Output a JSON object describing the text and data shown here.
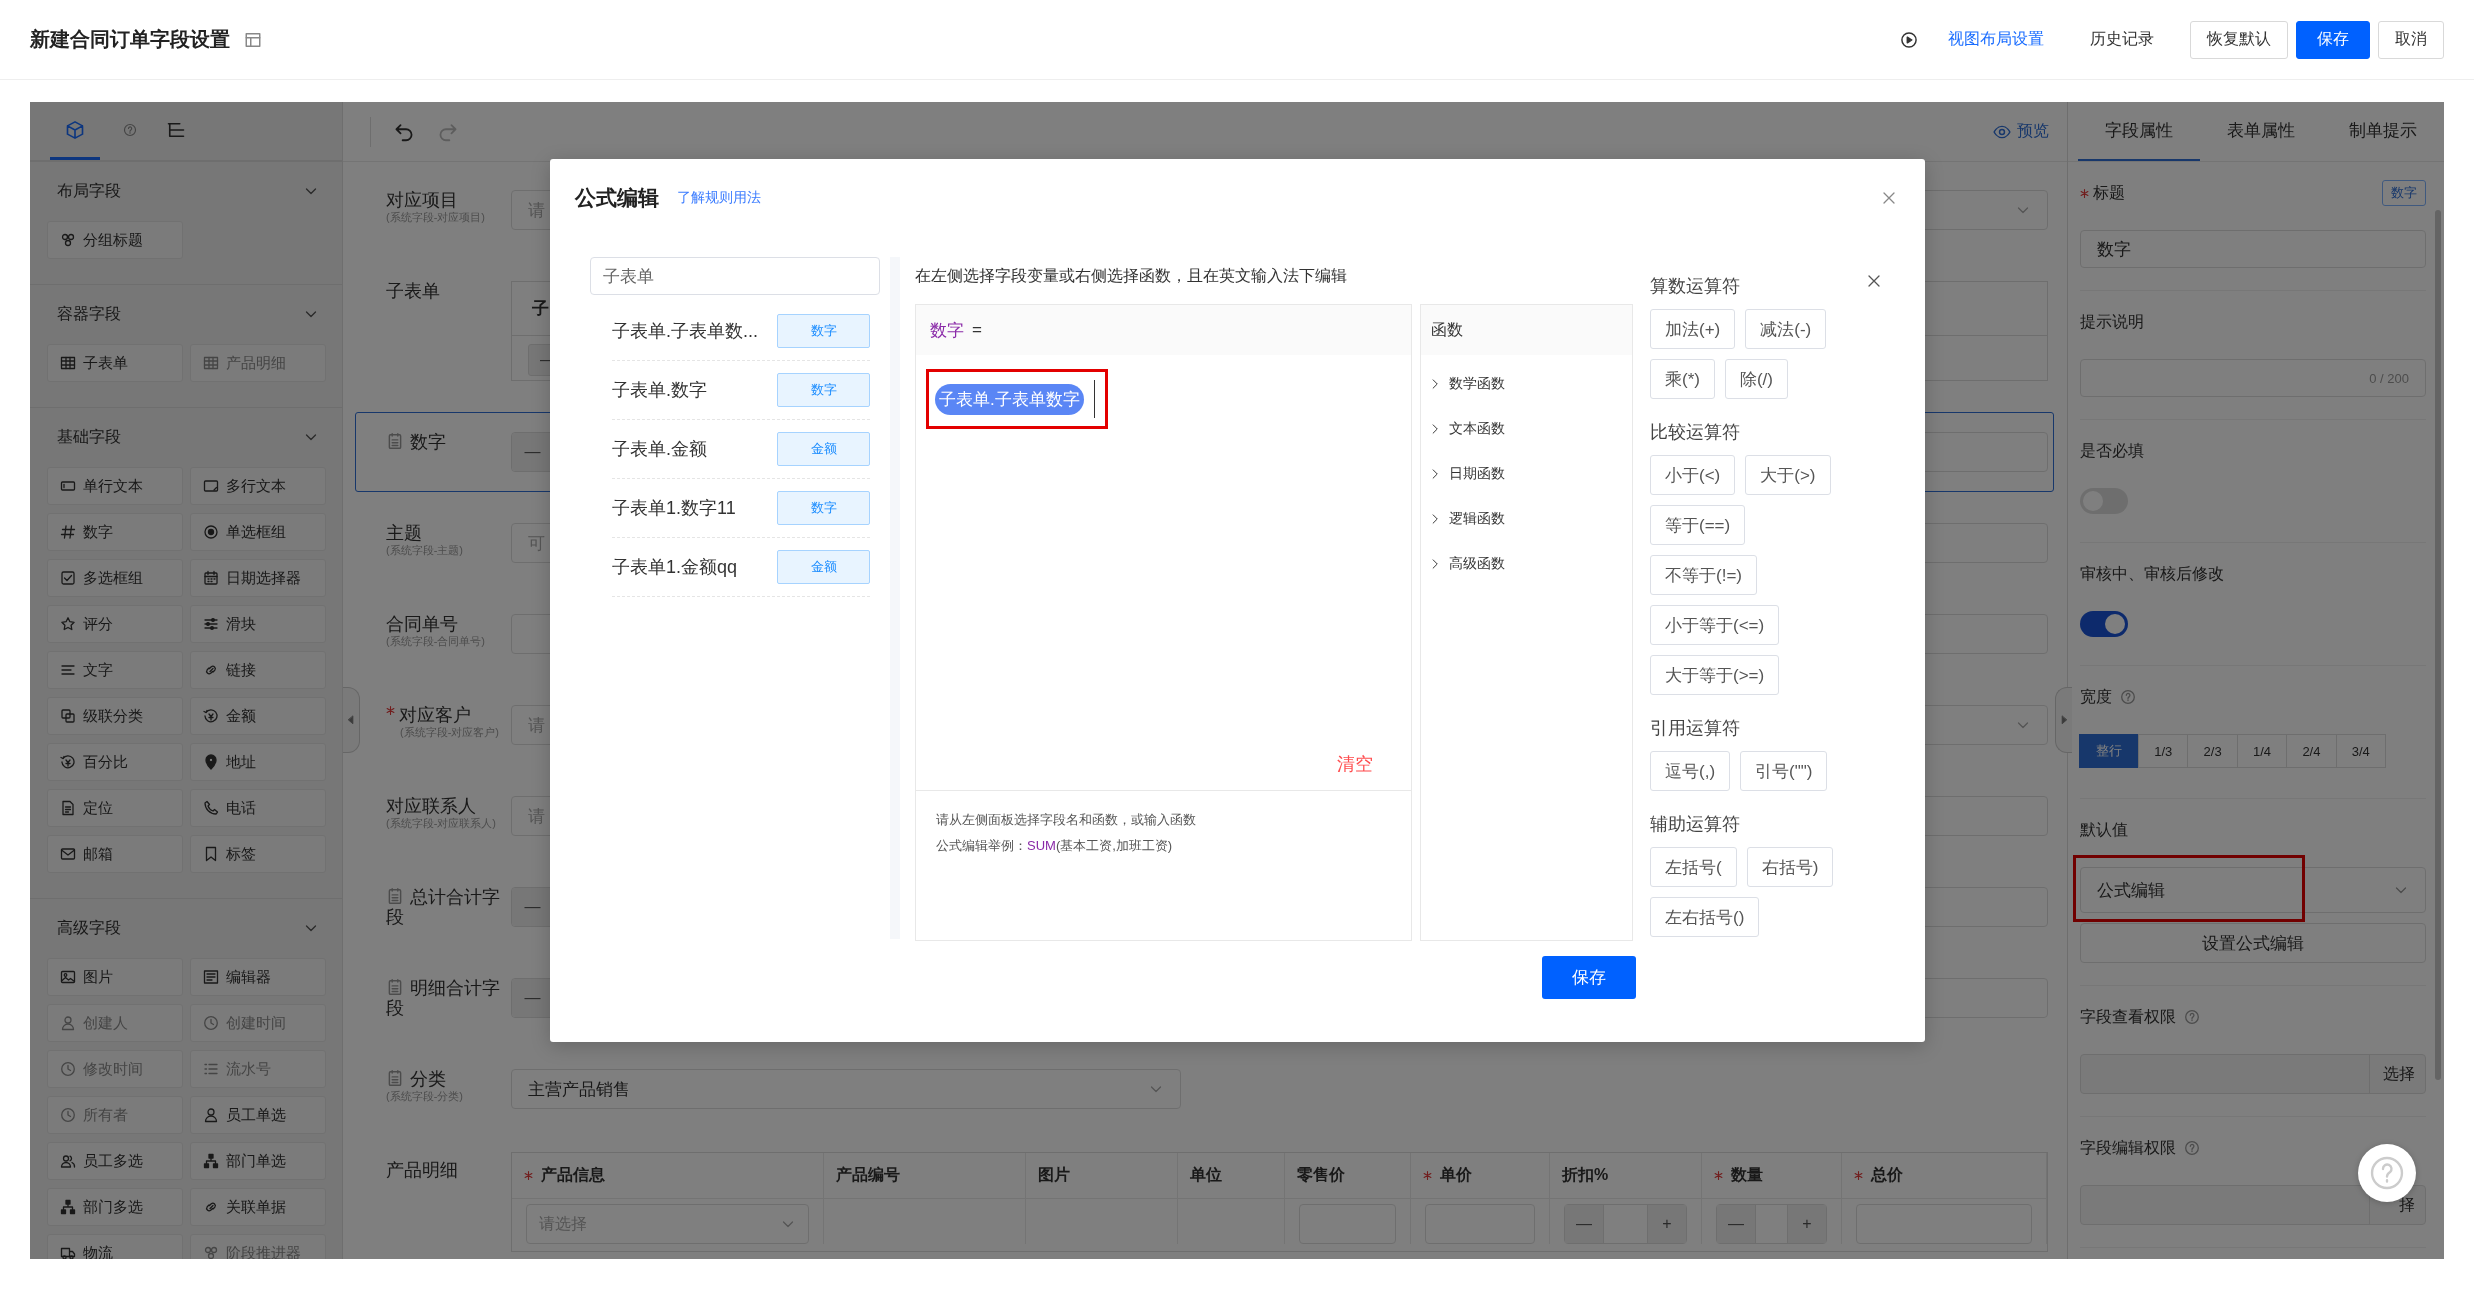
{
  "header": {
    "title": "新建合同订单字段设置",
    "actions": [
      {
        "label": "视图布局设置",
        "kind": "link"
      },
      {
        "label": "历史记录",
        "kind": "text"
      },
      {
        "label": "恢复默认",
        "kind": "default"
      },
      {
        "label": "保存",
        "kind": "primary"
      },
      {
        "label": "取消",
        "kind": "default"
      }
    ]
  },
  "sidebar": {
    "tabs": [
      {
        "kind": "components",
        "selected": true
      },
      {
        "kind": "help",
        "selected": false
      },
      {
        "kind": "outline",
        "selected": false
      }
    ],
    "sections": [
      {
        "title": "布局字段",
        "expanded": true,
        "items": [
          {
            "label": "分组标题",
            "disabled": false
          }
        ]
      },
      {
        "title": "容器字段",
        "expanded": true,
        "items": [
          {
            "label": "子表单",
            "disabled": false
          },
          {
            "label": "产品明细",
            "disabled": true
          }
        ]
      },
      {
        "title": "基础字段",
        "expanded": true,
        "items": [
          {
            "label": "单行文本",
            "disabled": false
          },
          {
            "label": "多行文本",
            "disabled": false
          },
          {
            "label": "数字",
            "disabled": false
          },
          {
            "label": "单选框组",
            "disabled": false
          },
          {
            "label": "多选框组",
            "disabled": false
          },
          {
            "label": "日期选择器",
            "disabled": false
          },
          {
            "label": "评分",
            "disabled": false
          },
          {
            "label": "滑块",
            "disabled": false
          },
          {
            "label": "文字",
            "disabled": false
          },
          {
            "label": "链接",
            "disabled": false
          },
          {
            "label": "级联分类",
            "disabled": false
          },
          {
            "label": "金额",
            "disabled": false
          },
          {
            "label": "百分比",
            "disabled": false
          },
          {
            "label": "地址",
            "disabled": false
          },
          {
            "label": "定位",
            "disabled": false
          },
          {
            "label": "电话",
            "disabled": false
          },
          {
            "label": "邮箱",
            "disabled": false
          },
          {
            "label": "标签",
            "disabled": false
          }
        ]
      },
      {
        "title": "高级字段",
        "expanded": true,
        "items": [
          {
            "label": "图片",
            "disabled": false
          },
          {
            "label": "编辑器",
            "disabled": false
          },
          {
            "label": "创建人",
            "disabled": true
          },
          {
            "label": "创建时间",
            "disabled": true
          },
          {
            "label": "修改时间",
            "disabled": true
          },
          {
            "label": "流水号",
            "disabled": true
          },
          {
            "label": "所有者",
            "disabled": true
          },
          {
            "label": "员工单选",
            "disabled": false
          },
          {
            "label": "员工多选",
            "disabled": false
          },
          {
            "label": "部门单选",
            "disabled": false
          },
          {
            "label": "部门多选",
            "disabled": false
          },
          {
            "label": "关联单据",
            "disabled": false
          },
          {
            "label": "物流",
            "disabled": false
          },
          {
            "label": "阶段推进器",
            "disabled": true
          }
        ]
      }
    ]
  },
  "canvas": {
    "preview": "预览",
    "rows": [
      {
        "label": "对应项目",
        "sublabel": "(系统字段-对应项目)",
        "required": false,
        "field_icon": false,
        "selected": false,
        "kind": "select",
        "placeholder": "请"
      },
      {
        "label": "子表单",
        "required": false,
        "field_icon": false,
        "selected": false,
        "kind": "subtable",
        "value": "子",
        "minus": "—"
      },
      {
        "label": "数字",
        "required": false,
        "field_icon": true,
        "selected": true,
        "kind": "stepper",
        "minus": "—"
      },
      {
        "label": "主题",
        "sublabel": "(系统字段-主题)",
        "required": false,
        "field_icon": false,
        "selected": false,
        "kind": "input",
        "placeholder": "可"
      },
      {
        "label": "合同单号",
        "sublabel": "(系统字段-合同单号)",
        "required": false,
        "field_icon": false,
        "selected": false,
        "kind": "input"
      },
      {
        "label": "对应客户",
        "sublabel": "(系统字段-对应客户)",
        "required": true,
        "field_icon": false,
        "selected": false,
        "kind": "select",
        "placeholder": "请"
      },
      {
        "label": "对应联系人",
        "sublabel": "(系统字段-对应联系人)",
        "required": false,
        "field_icon": false,
        "selected": false,
        "kind": "input",
        "placeholder": "请"
      },
      {
        "label": "总计合计字段",
        "required": false,
        "field_icon": true,
        "selected": false,
        "kind": "stepper",
        "minus": "—"
      },
      {
        "label": "明细合计字段",
        "required": false,
        "field_icon": true,
        "selected": false,
        "kind": "stepper",
        "minus": "—"
      },
      {
        "label": "分类",
        "sublabel": "(系统字段-分类)",
        "required": false,
        "field_icon": true,
        "selected": false,
        "kind": "short-select",
        "value": "主营产品销售"
      },
      {
        "label": "产品明细",
        "required": false,
        "field_icon": false,
        "selected": false,
        "kind": "table",
        "columns": [
          {
            "label": "产品信息",
            "required": true
          },
          {
            "label": "产品编号",
            "required": false
          },
          {
            "label": "图片",
            "required": false
          },
          {
            "label": "单位",
            "required": false
          },
          {
            "label": "零售价",
            "required": false
          },
          {
            "label": "单价",
            "required": true
          },
          {
            "label": "折扣%",
            "required": false
          },
          {
            "label": "数量",
            "required": true
          },
          {
            "label": "总价",
            "required": true
          }
        ],
        "cells": [
          {
            "kind": "select",
            "placeholder": "请选择"
          },
          {
            "kind": "empty"
          },
          {
            "kind": "empty"
          },
          {
            "kind": "empty"
          },
          {
            "kind": "input"
          },
          {
            "kind": "input"
          },
          {
            "kind": "stepper",
            "minus": "—",
            "plus": "+"
          },
          {
            "kind": "stepper",
            "minus": "—",
            "plus": "+"
          },
          {
            "kind": "input"
          }
        ]
      }
    ]
  },
  "properties": {
    "tabs": [
      {
        "label": "字段属性",
        "selected": true
      },
      {
        "label": "表单属性",
        "selected": false
      },
      {
        "label": "制单提示",
        "selected": false
      }
    ],
    "sections": [
      {
        "kind": "input",
        "label": "标题",
        "required": true,
        "help": false,
        "badge": "数字",
        "value": "数字"
      },
      {
        "kind": "textarea",
        "label": "提示说明",
        "required": false,
        "help": false,
        "counter": "0 / 200"
      },
      {
        "kind": "toggle",
        "label": "是否必填",
        "required": false,
        "help": false,
        "on": false
      },
      {
        "kind": "toggle",
        "label": "审核中、审核后修改",
        "required": false,
        "help": false,
        "on": true
      },
      {
        "kind": "segmented",
        "label": "宽度",
        "required": false,
        "help": true,
        "options": [
          {
            "label": "整行",
            "selected": true
          },
          {
            "label": "1/3",
            "selected": false
          },
          {
            "label": "2/3",
            "selected": false
          },
          {
            "label": "1/4",
            "selected": false
          },
          {
            "label": "2/4",
            "selected": false
          },
          {
            "label": "3/4",
            "selected": false
          }
        ]
      },
      {
        "kind": "select",
        "label": "默认值",
        "required": false,
        "help": false,
        "value": "公式编辑",
        "highlighted": true,
        "button": "设置公式编辑"
      },
      {
        "kind": "picker",
        "label": "字段查看权限",
        "required": false,
        "help": true,
        "addon": "选择"
      },
      {
        "kind": "picker",
        "label": "字段编辑权限",
        "required": false,
        "help": true,
        "addon": "择"
      }
    ]
  },
  "modal": {
    "title": "公式编辑",
    "help_link": "了解规则用法",
    "search": {
      "value": "子表单"
    },
    "fields": [
      {
        "name": "子表单.子表单数...",
        "type": "数字"
      },
      {
        "name": "子表单.数字",
        "type": "数字"
      },
      {
        "name": "子表单.金额",
        "type": "金额"
      },
      {
        "name": "子表单1.数字11",
        "type": "数字"
      },
      {
        "name": "子表单1.金额qq",
        "type": "金额"
      }
    ],
    "instruction": "在左侧选择字段变量或右侧选择函数，且在英文输入法下编辑",
    "editor": {
      "target": "数字",
      "operator": "=",
      "tokens": [
        {
          "text": "子表单.子表单数字",
          "highlighted": true
        }
      ],
      "clear": "清空",
      "tips": [
        {
          "text": "请从左侧面板选择字段名和函数，或输入函数"
        },
        {
          "text": "公式编辑举例：",
          "function": "SUM",
          "args": "(基本工资,加班工资)"
        }
      ]
    },
    "functions": {
      "title": "函数",
      "groups": [
        {
          "label": "数学函数",
          "expanded": false
        },
        {
          "label": "文本函数",
          "expanded": false
        },
        {
          "label": "日期函数",
          "expanded": false
        },
        {
          "label": "逻辑函数",
          "expanded": false
        },
        {
          "label": "高级函数",
          "expanded": false
        }
      ]
    },
    "operators": [
      {
        "title": "算数运算符",
        "buttons": [
          "加法(+)",
          "减法(-)",
          "乘(*)",
          "除(/)"
        ]
      },
      {
        "title": "比较运算符",
        "buttons": [
          "小于(<)",
          "大于(>)",
          "等于(==)",
          "不等于(!=)",
          "小于等于(<=)",
          "大于等于(>=)"
        ]
      },
      {
        "title": "引用运算符",
        "buttons": [
          "逗号(,)",
          "引号(\"\")"
        ]
      },
      {
        "title": "辅助运算符",
        "buttons": [
          "左括号(",
          "右括号)",
          "左右括号()"
        ]
      }
    ],
    "save": "保存"
  }
}
